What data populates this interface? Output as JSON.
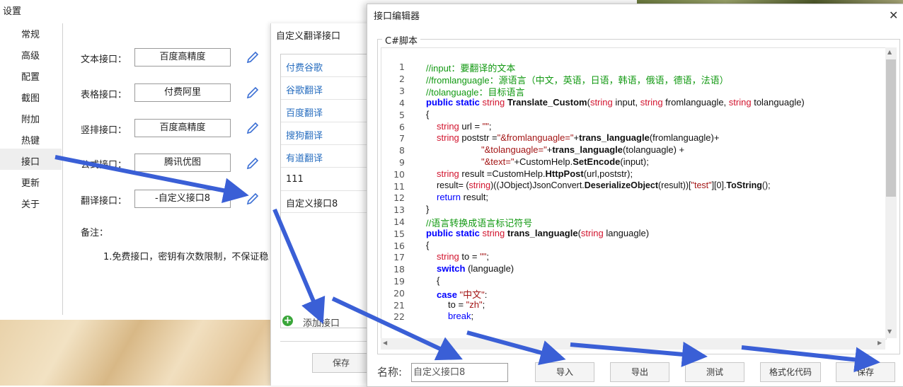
{
  "settings": {
    "title": "设置",
    "nav": [
      "常规",
      "高级",
      "配置",
      "截图",
      "附加",
      "热键",
      "接口",
      "更新",
      "关于"
    ],
    "selected_nav": "接口",
    "apis": [
      {
        "label": "文本接口：",
        "value": "百度高精度"
      },
      {
        "label": "表格接口：",
        "value": "付费阿里"
      },
      {
        "label": "竖排接口：",
        "value": "百度高精度"
      },
      {
        "label": "公式接口：",
        "value": "腾讯优图"
      },
      {
        "label": "翻译接口：",
        "value": "-自定义接口8"
      }
    ],
    "notes_label": "备注：",
    "notes_text": "1.免费接口，密钥有次数限制，不保证稳"
  },
  "custom_dialog": {
    "title": "自定义翻译接口",
    "items": [
      "付费谷歌",
      "谷歌翻译",
      "百度翻译",
      "搜狗翻译",
      "有道翻译",
      "111",
      "自定义接口8"
    ],
    "add_label": "添加接口",
    "save_label": "保存"
  },
  "editor": {
    "title": "接口编辑器",
    "close_glyph": "✕",
    "group_label": "C#脚本",
    "line_numbers": [
      "1",
      "2",
      "3",
      "4",
      "5",
      "6",
      "7",
      "8",
      "9",
      "10",
      "11",
      "12",
      "13",
      "14",
      "15",
      "16",
      "17",
      "18",
      "19",
      "20",
      "21",
      "22"
    ],
    "code": {
      "l1": "//input：要翻译的文本",
      "l2": "//fromlanguagle：源语言（中文，英语，日语，韩语，俄语，德语，法语）",
      "l3": "//tolanguagle：目标语言",
      "l4_a": "public static ",
      "l4_b": "string",
      "l4_c": " Translate_Custom",
      "l4_d": "(",
      "l4_e": "string",
      "l4_f": " input, ",
      "l4_g": "string",
      "l4_h": " fromlanguagle, ",
      "l4_i": "string",
      "l4_j": " tolanguagle)",
      "l5": "{",
      "l6_a": "string",
      "l6_b": " url = ",
      "l6_c": "\"\"",
      "l6_d": ";",
      "l7_a": "string",
      "l7_b": " poststr =",
      "l7_c": "\"&fromlanguagle=\"",
      "l7_d": "+",
      "l7_e": "trans_languagle",
      "l7_f": "(fromlanguagle)+",
      "l8_a": "\"&tolanguagle=\"",
      "l8_b": "+",
      "l8_c": "trans_languagle",
      "l8_d": "(tolanguagle) +",
      "l9_a": "\"&text=\"",
      "l9_b": "+CustomHelp.",
      "l9_c": "SetEncode",
      "l9_d": "(input);",
      "l10_a": "string",
      "l10_b": " result =CustomHelp.",
      "l10_c": "HttpPost",
      "l10_d": "(url,poststr);",
      "l11_a": "result= (",
      "l11_b": "string",
      "l11_c": ")((JObject)JsonConvert.",
      "l11_d": "DeserializeObject",
      "l11_e": "(result))[",
      "l11_f": "\"test\"",
      "l11_g": "][0].",
      "l11_h": "ToString",
      "l11_i": "();",
      "l12_a": "return",
      "l12_b": " result;",
      "l13": "}",
      "l14": "//语言转换成语言标记符号",
      "l15_a": "public static ",
      "l15_b": "string",
      "l15_c": " trans_languagle",
      "l15_d": "(",
      "l15_e": "string",
      "l15_f": " languagle)",
      "l16": "{",
      "l17_a": "string",
      "l17_b": " to = ",
      "l17_c": "\"\"",
      "l17_d": ";",
      "l18_a": "switch",
      "l18_b": " (languagle)",
      "l19": "{",
      "l20_a": "case",
      "l20_b": " ",
      "l20_c": "\"中文\"",
      "l20_d": ":",
      "l21_a": "to = ",
      "l21_b": "\"zh\"",
      "l21_c": ";",
      "l22_a": "break",
      "l22_b": ";"
    },
    "name_label": "名称:",
    "name_value": "自定义接口8",
    "buttons": {
      "import": "导入",
      "export": "导出",
      "test": "测试",
      "format": "格式化代码",
      "save": "保存"
    }
  }
}
